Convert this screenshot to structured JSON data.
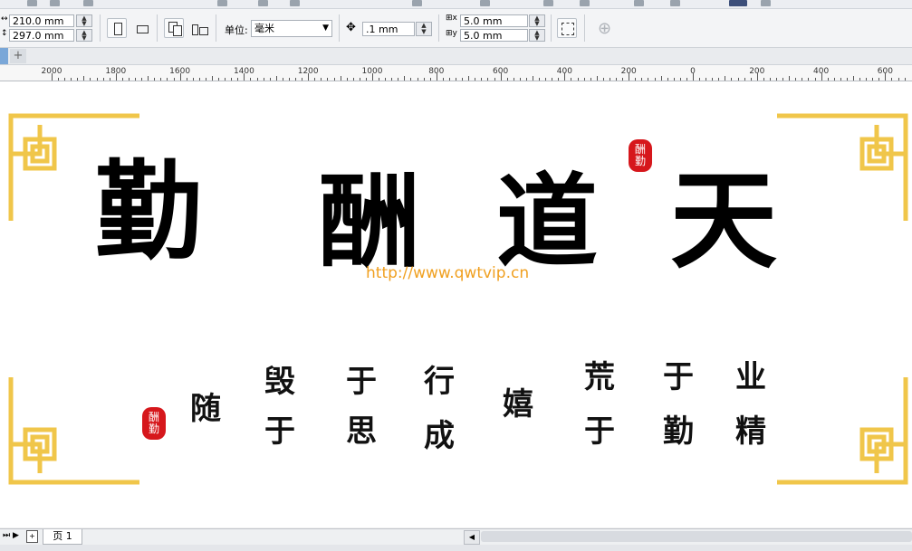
{
  "property_bar": {
    "width_value": "210.0 mm",
    "height_value": "297.0 mm",
    "units_label": "单位:",
    "units_value": "毫米",
    "nudge_value": ".1 mm",
    "dup_x_value": "5.0 mm",
    "dup_y_value": "5.0 mm"
  },
  "ruler": {
    "labels": [
      "2000",
      "1800",
      "1600",
      "1400",
      "1200",
      "1000",
      "800",
      "600",
      "400",
      "200",
      "0",
      "200",
      "400",
      "600"
    ]
  },
  "artwork": {
    "big_chars": [
      "勤",
      "酬",
      "道",
      "天"
    ],
    "small_chars": [
      "随",
      "毁",
      "于",
      "于",
      "思",
      "行",
      "成",
      "嬉",
      "荒",
      "于",
      "于",
      "勤",
      "业",
      "精"
    ],
    "seal_text": [
      "酬",
      "勤"
    ],
    "watermark_url": "http://www.qwtvip.cn",
    "colors": {
      "frame": "#f0c64a",
      "seal": "#d6171c",
      "ink": "#000000",
      "watermark": "#f0a020"
    }
  },
  "bottom_bar": {
    "page_tab": "页 1"
  }
}
